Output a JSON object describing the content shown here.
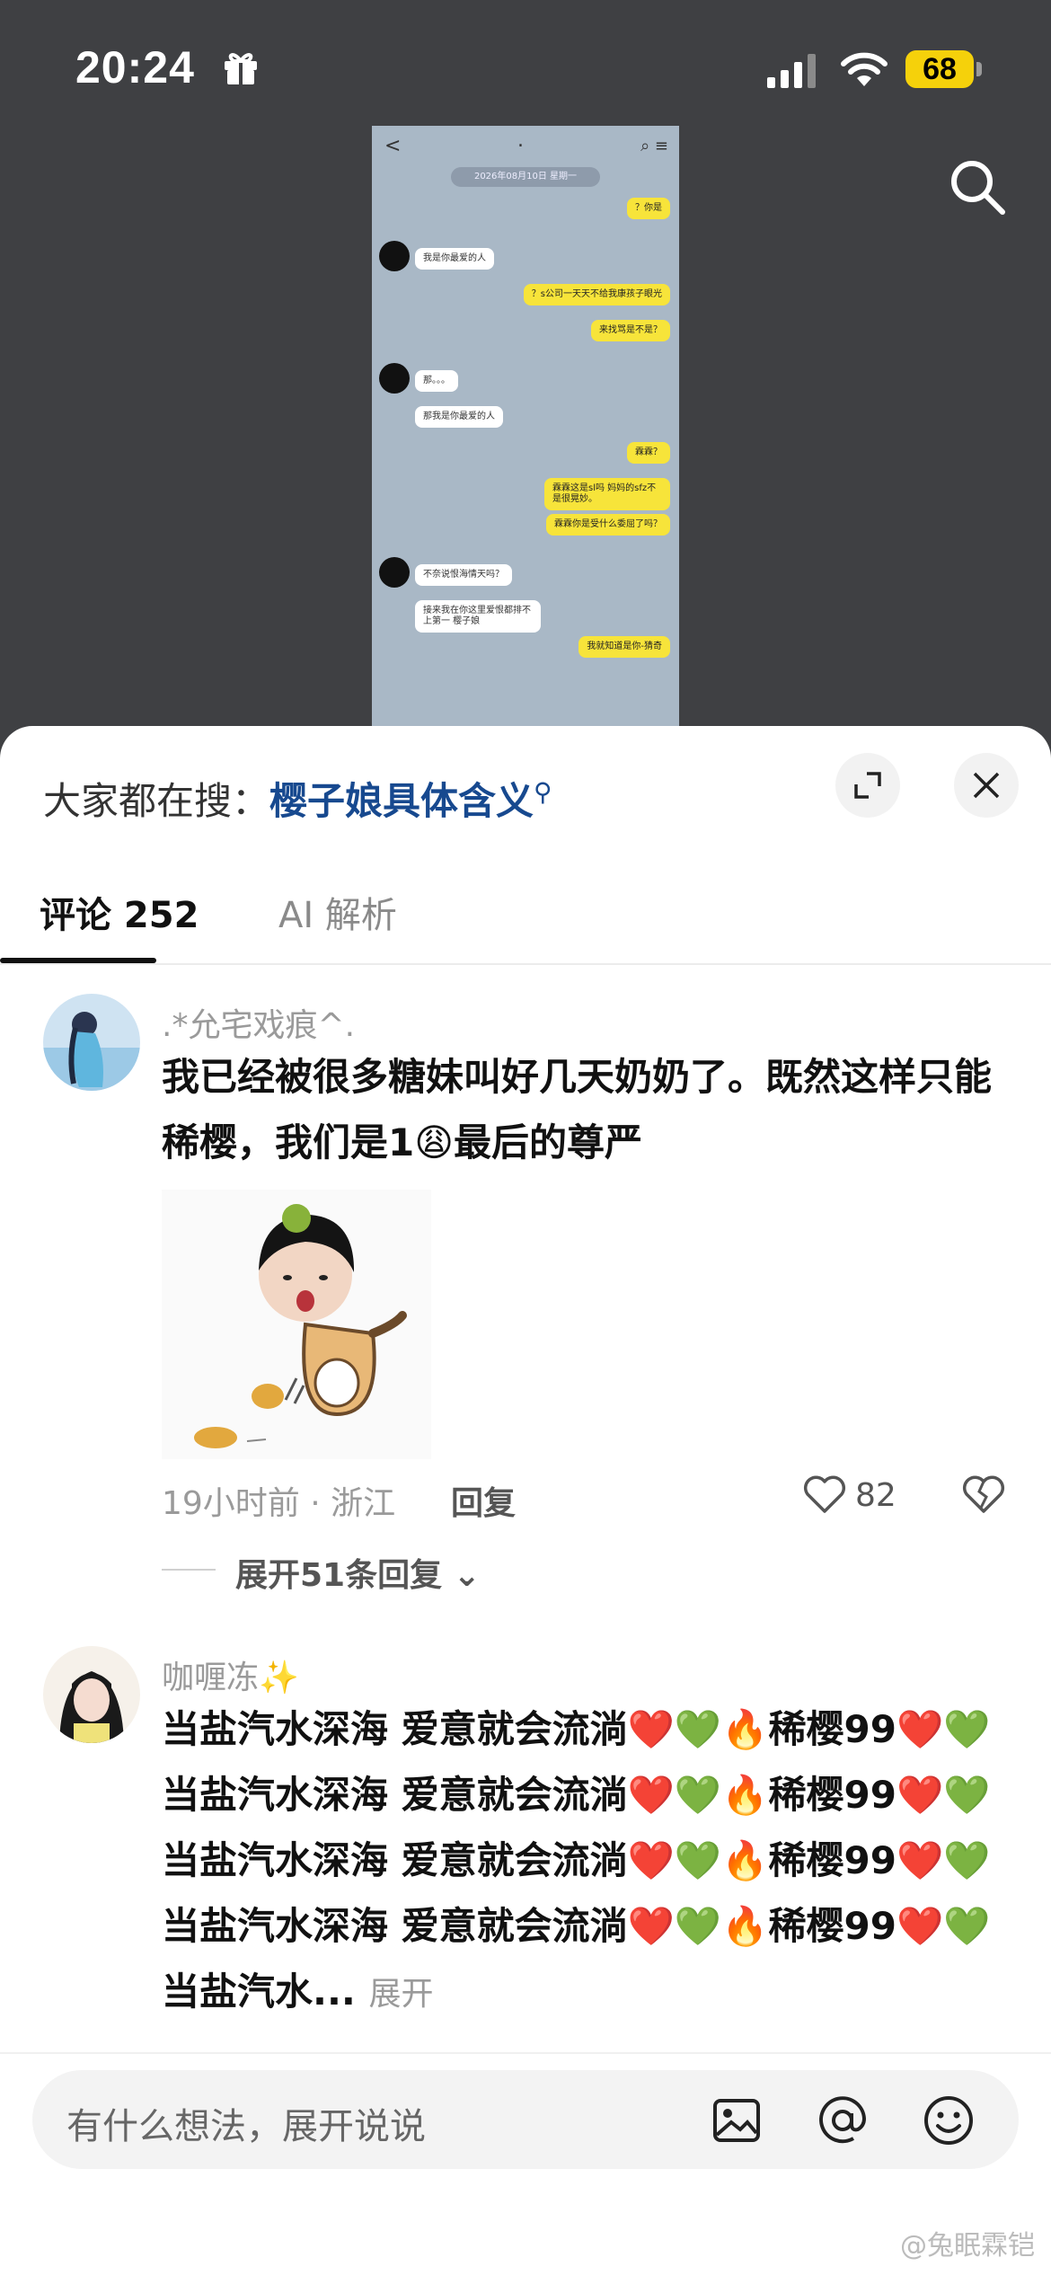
{
  "status_bar": {
    "time": "20:24",
    "battery": "68",
    "icons": [
      "gift-icon",
      "signal-icon",
      "wifi-icon",
      "battery-icon"
    ]
  },
  "preview": {
    "nav_back": "<",
    "nav_title": ".",
    "date": "2026年08月10日 星期一",
    "messages": [
      {
        "side": "right",
        "text": "？你是"
      },
      {
        "side": "left",
        "text": "我是你最爱的人"
      },
      {
        "side": "right",
        "text": "？s公司一天天不给我康孩子眼光"
      },
      {
        "side": "right",
        "text": "来找骂是不是？"
      },
      {
        "side": "left",
        "text": "那。。。"
      },
      {
        "side": "left",
        "text": "那我是你最爱的人"
      },
      {
        "side": "right",
        "text": "霖霖？"
      },
      {
        "side": "right",
        "text": "霖霖这是sl吗 妈妈的sfz不是很晃妙。"
      },
      {
        "side": "right",
        "text": "霖霖你是受什么委屈了吗？"
      },
      {
        "side": "left",
        "text": "不奈说恨海情天吗？"
      },
      {
        "side": "left",
        "text": "接来我在你这里爱恨都排不上第一 樱子娘"
      },
      {
        "side": "right",
        "text": "我就知道是你-猜奇"
      }
    ]
  },
  "sheet": {
    "search_prefix": "大家都在搜：",
    "search_keyword": "樱子娘具体含义",
    "tabs": [
      {
        "label": "评论 252",
        "active": true
      },
      {
        "label": "AI 解析",
        "active": false
      }
    ]
  },
  "comments": [
    {
      "user": ".*允宅戏痕^.",
      "text": "我已经被很多糖妹叫好几天奶奶了。既然这样只能稀樱，我们是1😩最后的尊严",
      "meta": "19小时前 · 浙江",
      "reply_label": "回复",
      "likes": "82",
      "expand_replies": "展开51条回复"
    },
    {
      "user": "咖喱冻✨",
      "text": "当盐汽水深海 爱意就会流淌❤️💚🔥稀樱99❤️💚当盐汽水深海 爱意就会流淌❤️💚🔥稀樱99❤️💚当盐汽水深海 爱意就会流淌❤️💚🔥稀樱99❤️💚当盐汽水深海 爱意就会流淌❤️💚🔥稀樱99❤️💚当盐汽水...",
      "expand_label": "展开"
    }
  ],
  "input": {
    "placeholder": "有什么想法，展开说说",
    "icons": [
      "image-icon",
      "at-icon",
      "emoji-icon"
    ]
  },
  "watermark": "@兔眠霖铠",
  "colors": {
    "keyword_blue": "#17498f",
    "battery_yellow": "#f5d10b",
    "bubble_yellow": "#f7e43a"
  }
}
